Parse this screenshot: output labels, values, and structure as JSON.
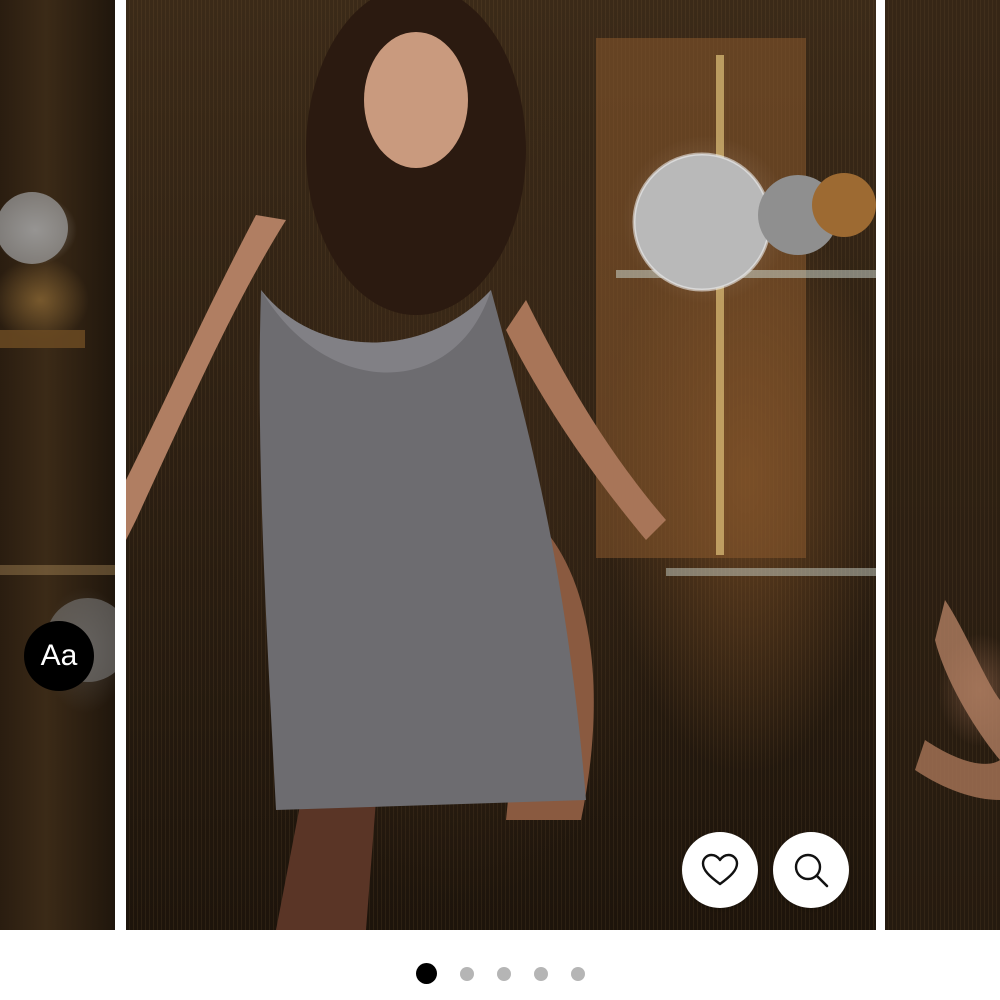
{
  "gallery": {
    "font_badge_label": "Aa",
    "wishlist_icon": "heart-icon",
    "zoom_icon": "search-icon",
    "total_slides": 5,
    "active_slide": 1,
    "dot_active_color": "#000000",
    "dot_inactive_color": "#b5b5b5"
  }
}
